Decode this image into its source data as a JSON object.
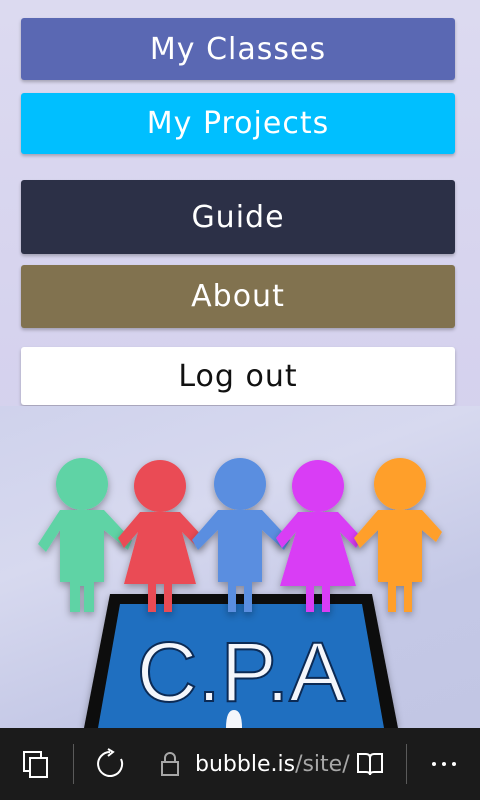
{
  "menu": {
    "my_classes": "My Classes",
    "my_projects": "My Projects",
    "guide": "Guide",
    "about": "About",
    "log_out": "Log out"
  },
  "logo": {
    "text": "C.P.A",
    "figure_colors": [
      "#5fd3a5",
      "#ea4c55",
      "#5a8ee0",
      "#d93cf5",
      "#ff9f2a"
    ],
    "screen_color": "#1f6fc0"
  },
  "colors": {
    "my_classes_bg": "#5a68b3",
    "my_projects_bg": "#00bfff",
    "guide_bg": "#2c3047",
    "about_bg": "#81724f",
    "log_out_bg": "#ffffff"
  },
  "browser_bar": {
    "url_host": "bubble.is",
    "url_path": "/site/",
    "tabs_icon": "tabs-icon",
    "refresh_icon": "refresh-icon",
    "lock_icon": "lock-icon",
    "reading_icon": "reading-view-icon",
    "more_icon": "more-icon"
  }
}
